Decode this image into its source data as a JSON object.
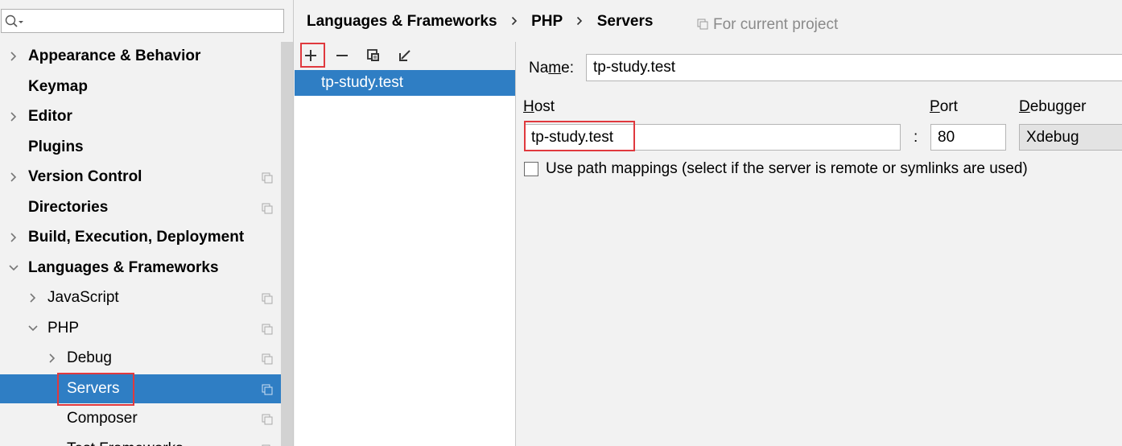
{
  "search": {
    "value": "",
    "placeholder": ""
  },
  "sidebar": {
    "items": [
      {
        "label": "Appearance & Behavior",
        "bold": true,
        "expandable": true,
        "expanded": false,
        "project_scoped": false
      },
      {
        "label": "Keymap",
        "bold": true,
        "expandable": false,
        "project_scoped": false
      },
      {
        "label": "Editor",
        "bold": true,
        "expandable": true,
        "expanded": false,
        "project_scoped": false
      },
      {
        "label": "Plugins",
        "bold": true,
        "expandable": false,
        "project_scoped": false
      },
      {
        "label": "Version Control",
        "bold": true,
        "expandable": true,
        "expanded": false,
        "project_scoped": true
      },
      {
        "label": "Directories",
        "bold": true,
        "expandable": false,
        "project_scoped": true
      },
      {
        "label": "Build, Execution, Deployment",
        "bold": true,
        "expandable": true,
        "expanded": false,
        "project_scoped": false
      },
      {
        "label": "Languages & Frameworks",
        "bold": true,
        "expandable": true,
        "expanded": true,
        "project_scoped": false
      },
      {
        "label": "JavaScript",
        "bold": false,
        "expandable": true,
        "expanded": false,
        "project_scoped": true
      },
      {
        "label": "PHP",
        "bold": false,
        "expandable": true,
        "expanded": true,
        "project_scoped": true
      },
      {
        "label": "Debug",
        "bold": false,
        "expandable": true,
        "expanded": false,
        "project_scoped": true
      },
      {
        "label": "Servers",
        "bold": false,
        "expandable": false,
        "project_scoped": true,
        "selected": true
      },
      {
        "label": "Composer",
        "bold": false,
        "expandable": false,
        "project_scoped": true
      },
      {
        "label": "Test Frameworks",
        "bold": false,
        "expandable": false,
        "project_scoped": true
      }
    ]
  },
  "breadcrumb": {
    "items": [
      "Languages & Frameworks",
      "PHP",
      "Servers"
    ]
  },
  "scope_note": "For current project",
  "toolbar": {
    "add": "add-icon",
    "remove": "remove-icon",
    "copy": "copy-icon",
    "import": "import-icon"
  },
  "servers": {
    "items": [
      {
        "label": "tp-study.test",
        "selected": true
      }
    ]
  },
  "form": {
    "name_label_pre": "Na",
    "name_label_mnemonic": "m",
    "name_label_post": "e:",
    "name_value": "tp-study.test",
    "host_label_mnemonic": "H",
    "host_label_rest": "ost",
    "host_value": "tp-study.test",
    "host_port_separator": ":",
    "port_label_mnemonic": "P",
    "port_label_rest": "ort",
    "port_value": "80",
    "debugger_label_mnemonic": "D",
    "debugger_label_rest": "ebugger",
    "debugger_value": "Xdebug",
    "path_mappings_label": "Use path mappings (select if the server is remote or symlinks are used)",
    "path_mappings_checked": false
  },
  "colors": {
    "selection": "#2f7ec4",
    "highlight": "#e0393e",
    "background": "#f2f2f2"
  }
}
